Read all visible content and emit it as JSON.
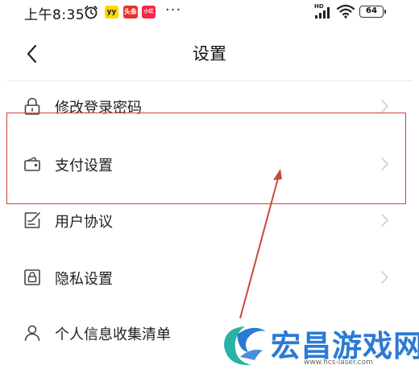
{
  "status_bar": {
    "time": "上午8:35",
    "apps": [
      "yy",
      "头条",
      "小红书"
    ],
    "more": "···",
    "network": "HD",
    "battery": "64"
  },
  "header": {
    "title": "设置"
  },
  "settings": {
    "items": [
      {
        "label": "修改登录密码",
        "icon": "lock-icon"
      },
      {
        "label": "支付设置",
        "icon": "wallet-icon"
      },
      {
        "label": "用户协议",
        "icon": "document-edit-icon"
      },
      {
        "label": "隐私设置",
        "icon": "privacy-lock-icon"
      },
      {
        "label": "个人信息收集清单",
        "icon": "person-icon"
      }
    ]
  },
  "annotation": {
    "highlighted_item": "支付设置",
    "color": "#d04040"
  },
  "watermark": {
    "text": "宏昌游戏网",
    "url": "www.hcs-laser.com",
    "color": "#2a7ad6"
  }
}
